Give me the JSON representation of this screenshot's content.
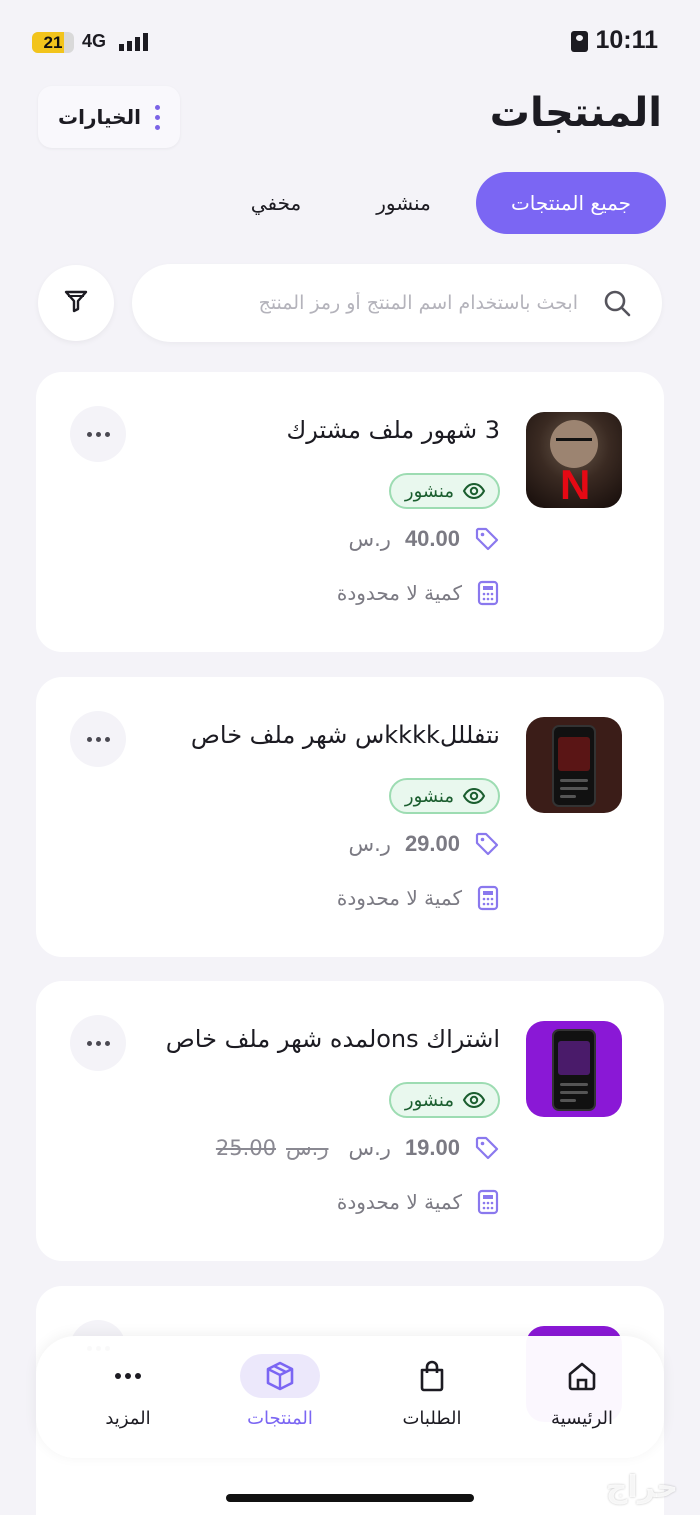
{
  "status_bar": {
    "time": "10:11",
    "battery": "21",
    "network": "4G"
  },
  "header": {
    "title": "المنتجات",
    "options_label": "الخيارات"
  },
  "tabs": [
    {
      "label": "جميع المنتجات",
      "active": true
    },
    {
      "label": "منشور",
      "active": false
    },
    {
      "label": "مخفي",
      "active": false
    }
  ],
  "search": {
    "placeholder": "ابحث باستخدام اسم المنتج أو رمز المنتج",
    "value": ""
  },
  "products": [
    {
      "name": "3 شهور ملف مشترك",
      "status": "منشور",
      "price": "40.00",
      "currency": "ر.س",
      "old_price": "",
      "quantity": "كمية لا محدودة",
      "thumb": "netflix-thumbnail"
    },
    {
      "name": "نتفلللkkkkس شهر ملف خاص",
      "status": "منشور",
      "price": "29.00",
      "currency": "ر.س",
      "old_price": "",
      "quantity": "كمية لا محدودة",
      "thumb": "netflix-phone-thumbnail"
    },
    {
      "name": "اشتراك onsلمده شهر ملف خاص",
      "status": "منشور",
      "price": "19.00",
      "currency": "ر.س",
      "old_price": "25.00",
      "quantity": "كمية لا محدودة",
      "thumb": "osn-phone-thumbnail"
    }
  ],
  "bottom_nav": {
    "items": [
      {
        "label": "الرئيسية",
        "icon": "home-icon",
        "active": false
      },
      {
        "label": "الطلبات",
        "icon": "bag-icon",
        "active": false
      },
      {
        "label": "المنتجات",
        "icon": "box-icon",
        "active": true
      },
      {
        "label": "المزيد",
        "icon": "more-icon",
        "active": false
      }
    ]
  },
  "watermark": "حراج",
  "colors": {
    "accent": "#7b66f3",
    "published_bg": "#e9f8ee",
    "published_text": "#1b5e2f"
  }
}
